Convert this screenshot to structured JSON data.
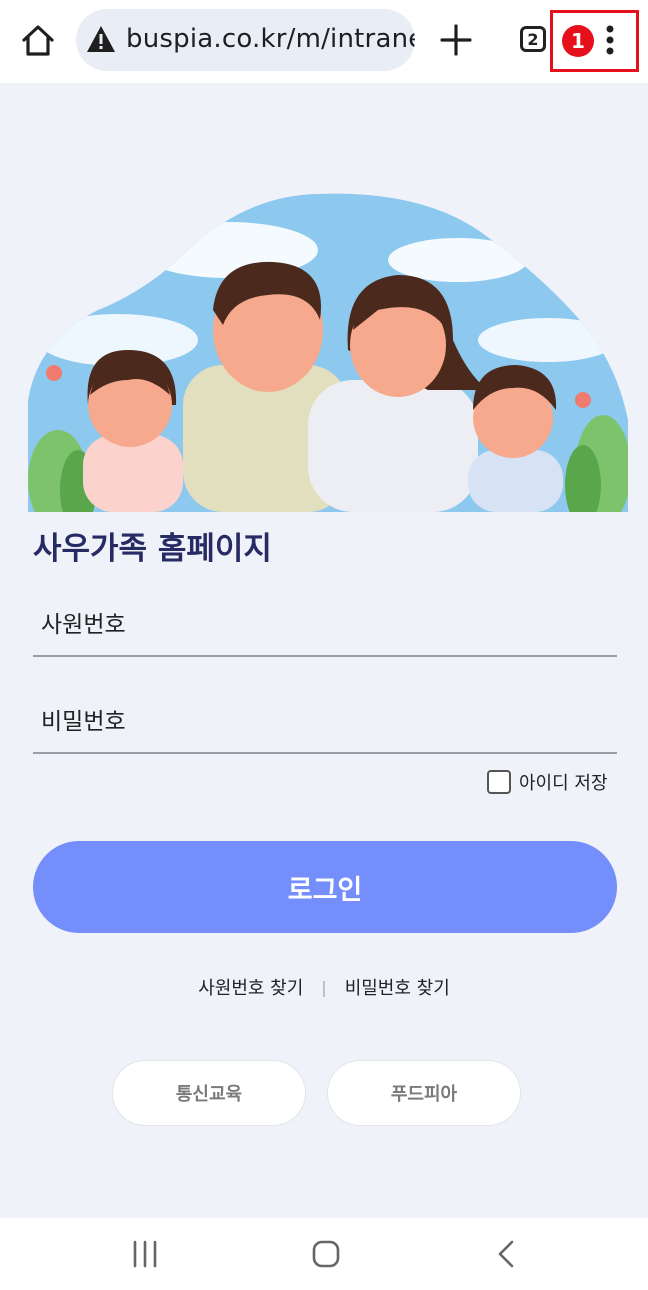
{
  "browser": {
    "url": "buspia.co.kr/m/intrane",
    "tab_count": "2",
    "notification_count": "1"
  },
  "page": {
    "title": "사우가족 홈페이지",
    "employee_id_placeholder": "사원번호",
    "password_placeholder": "비밀번호",
    "save_id_label": "아이디 저장",
    "login_label": "로그인",
    "find_employee_id": "사원번호 찾기",
    "separator": "|",
    "find_password": "비밀번호 찾기",
    "quick_links": [
      "통신교육",
      "푸드피아"
    ]
  },
  "icons": {
    "home": "home-icon",
    "warning": "warning-icon",
    "new_tab": "plus-icon",
    "menu": "more-vert-icon",
    "recents": "recents-icon",
    "home_nav": "home-nav-icon",
    "back": "back-icon"
  },
  "colors": {
    "accent": "#748ffc",
    "title": "#262b63",
    "highlight": "#e5101b",
    "background": "#f0f2fa"
  }
}
